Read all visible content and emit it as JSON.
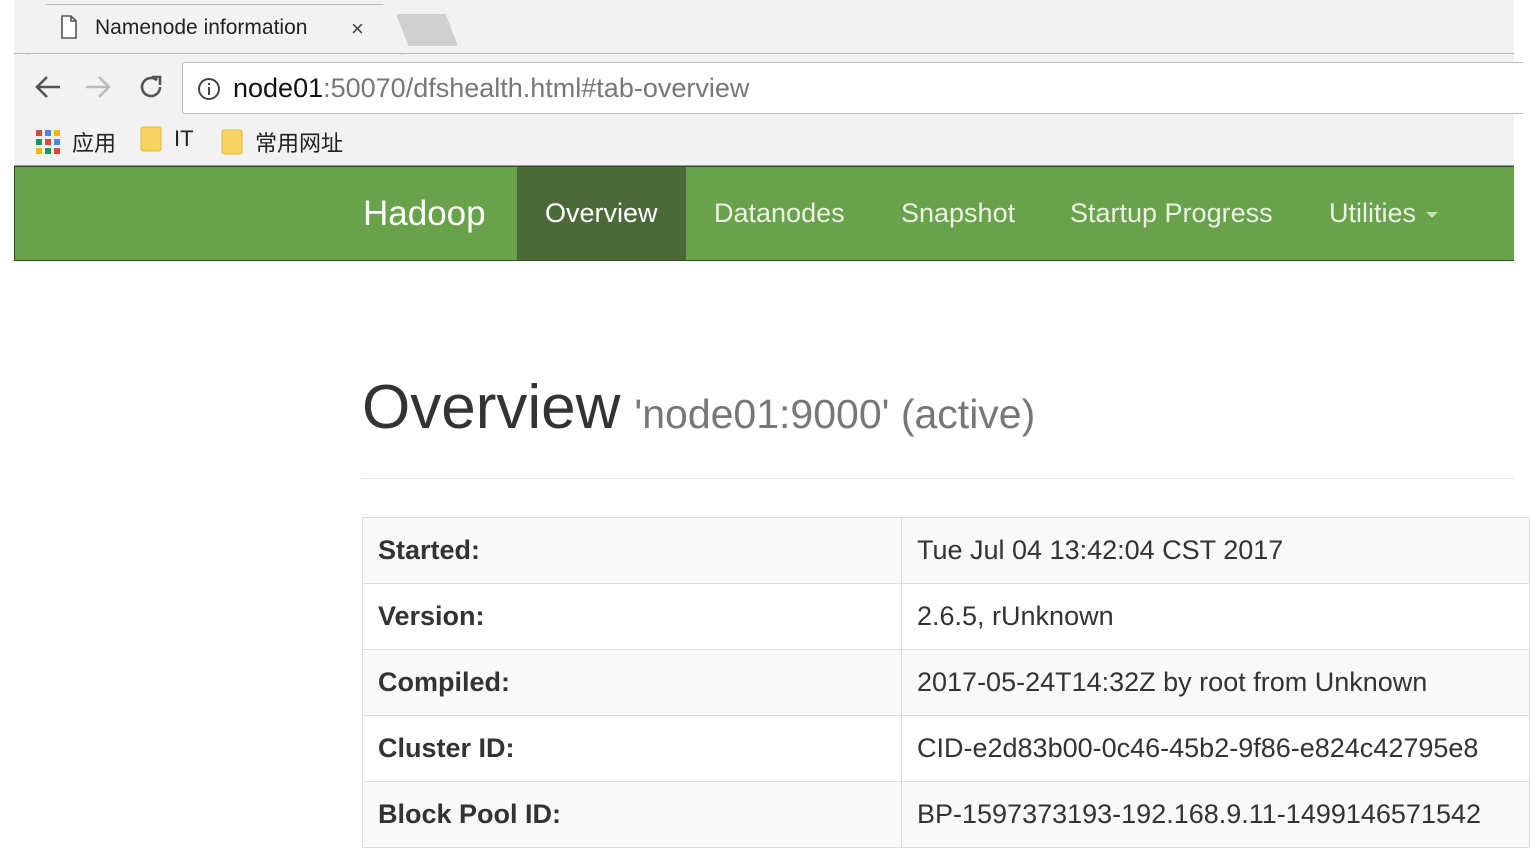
{
  "browser": {
    "tab_title": "Namenode information",
    "tab_close": "×",
    "url_host": "node01",
    "url_rest": ":50070/dfshealth.html#tab-overview",
    "bookmarks": [
      {
        "label": "应用",
        "icon": "apps-grid-icon"
      },
      {
        "label": "IT",
        "icon": "folder-icon"
      },
      {
        "label": "常用网址",
        "icon": "folder-icon"
      }
    ]
  },
  "navbar": {
    "brand": "Hadoop",
    "items": [
      "Overview",
      "Datanodes",
      "Snapshot",
      "Startup Progress",
      "Utilities"
    ],
    "active": "Overview",
    "color": "#6aa14b",
    "active_color": "#4c6a39"
  },
  "header": {
    "title": "Overview",
    "subtitle": "'node01:9000' (active)"
  },
  "info_table": [
    {
      "key": "Started:",
      "value": "Tue Jul 04 13:42:04 CST 2017"
    },
    {
      "key": "Version:",
      "value": "2.6.5, rUnknown"
    },
    {
      "key": "Compiled:",
      "value": "2017-05-24T14:32Z by root from Unknown"
    },
    {
      "key": "Cluster ID:",
      "value": "CID-e2d83b00-0c46-45b2-9f86-e824c42795e8"
    },
    {
      "key": "Block Pool ID:",
      "value": "BP-1597373193-192.168.9.11-1499146571542"
    }
  ]
}
